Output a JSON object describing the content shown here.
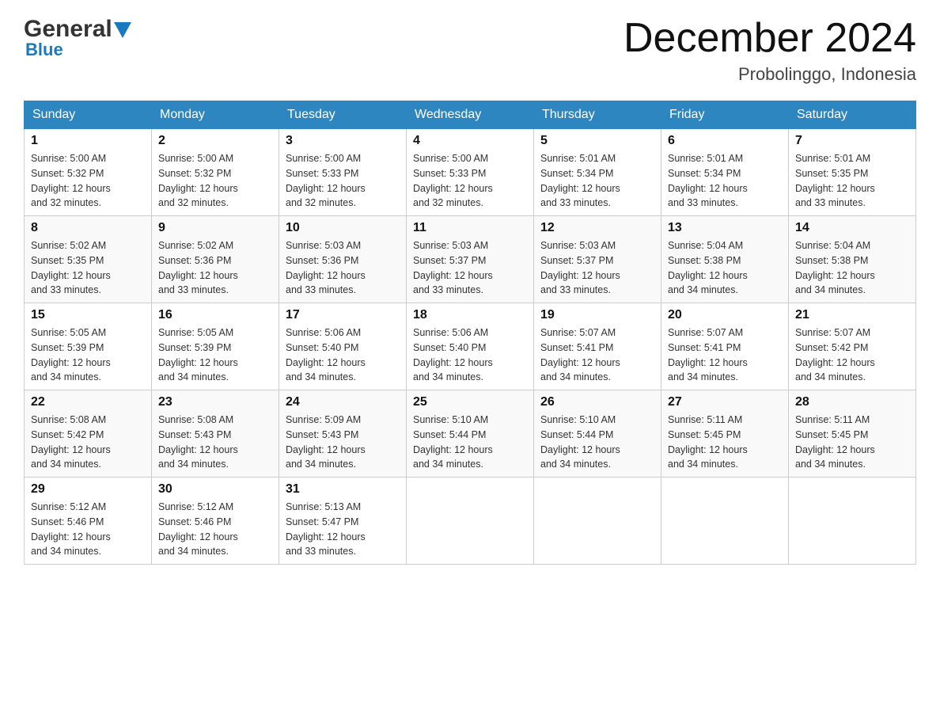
{
  "header": {
    "logo_general": "General",
    "logo_blue": "Blue",
    "month_year": "December 2024",
    "location": "Probolinggo, Indonesia"
  },
  "days_of_week": [
    "Sunday",
    "Monday",
    "Tuesday",
    "Wednesday",
    "Thursday",
    "Friday",
    "Saturday"
  ],
  "weeks": [
    [
      {
        "num": "1",
        "sunrise": "5:00 AM",
        "sunset": "5:32 PM",
        "daylight": "12 hours and 32 minutes."
      },
      {
        "num": "2",
        "sunrise": "5:00 AM",
        "sunset": "5:32 PM",
        "daylight": "12 hours and 32 minutes."
      },
      {
        "num": "3",
        "sunrise": "5:00 AM",
        "sunset": "5:33 PM",
        "daylight": "12 hours and 32 minutes."
      },
      {
        "num": "4",
        "sunrise": "5:00 AM",
        "sunset": "5:33 PM",
        "daylight": "12 hours and 32 minutes."
      },
      {
        "num": "5",
        "sunrise": "5:01 AM",
        "sunset": "5:34 PM",
        "daylight": "12 hours and 33 minutes."
      },
      {
        "num": "6",
        "sunrise": "5:01 AM",
        "sunset": "5:34 PM",
        "daylight": "12 hours and 33 minutes."
      },
      {
        "num": "7",
        "sunrise": "5:01 AM",
        "sunset": "5:35 PM",
        "daylight": "12 hours and 33 minutes."
      }
    ],
    [
      {
        "num": "8",
        "sunrise": "5:02 AM",
        "sunset": "5:35 PM",
        "daylight": "12 hours and 33 minutes."
      },
      {
        "num": "9",
        "sunrise": "5:02 AM",
        "sunset": "5:36 PM",
        "daylight": "12 hours and 33 minutes."
      },
      {
        "num": "10",
        "sunrise": "5:03 AM",
        "sunset": "5:36 PM",
        "daylight": "12 hours and 33 minutes."
      },
      {
        "num": "11",
        "sunrise": "5:03 AM",
        "sunset": "5:37 PM",
        "daylight": "12 hours and 33 minutes."
      },
      {
        "num": "12",
        "sunrise": "5:03 AM",
        "sunset": "5:37 PM",
        "daylight": "12 hours and 33 minutes."
      },
      {
        "num": "13",
        "sunrise": "5:04 AM",
        "sunset": "5:38 PM",
        "daylight": "12 hours and 34 minutes."
      },
      {
        "num": "14",
        "sunrise": "5:04 AM",
        "sunset": "5:38 PM",
        "daylight": "12 hours and 34 minutes."
      }
    ],
    [
      {
        "num": "15",
        "sunrise": "5:05 AM",
        "sunset": "5:39 PM",
        "daylight": "12 hours and 34 minutes."
      },
      {
        "num": "16",
        "sunrise": "5:05 AM",
        "sunset": "5:39 PM",
        "daylight": "12 hours and 34 minutes."
      },
      {
        "num": "17",
        "sunrise": "5:06 AM",
        "sunset": "5:40 PM",
        "daylight": "12 hours and 34 minutes."
      },
      {
        "num": "18",
        "sunrise": "5:06 AM",
        "sunset": "5:40 PM",
        "daylight": "12 hours and 34 minutes."
      },
      {
        "num": "19",
        "sunrise": "5:07 AM",
        "sunset": "5:41 PM",
        "daylight": "12 hours and 34 minutes."
      },
      {
        "num": "20",
        "sunrise": "5:07 AM",
        "sunset": "5:41 PM",
        "daylight": "12 hours and 34 minutes."
      },
      {
        "num": "21",
        "sunrise": "5:07 AM",
        "sunset": "5:42 PM",
        "daylight": "12 hours and 34 minutes."
      }
    ],
    [
      {
        "num": "22",
        "sunrise": "5:08 AM",
        "sunset": "5:42 PM",
        "daylight": "12 hours and 34 minutes."
      },
      {
        "num": "23",
        "sunrise": "5:08 AM",
        "sunset": "5:43 PM",
        "daylight": "12 hours and 34 minutes."
      },
      {
        "num": "24",
        "sunrise": "5:09 AM",
        "sunset": "5:43 PM",
        "daylight": "12 hours and 34 minutes."
      },
      {
        "num": "25",
        "sunrise": "5:10 AM",
        "sunset": "5:44 PM",
        "daylight": "12 hours and 34 minutes."
      },
      {
        "num": "26",
        "sunrise": "5:10 AM",
        "sunset": "5:44 PM",
        "daylight": "12 hours and 34 minutes."
      },
      {
        "num": "27",
        "sunrise": "5:11 AM",
        "sunset": "5:45 PM",
        "daylight": "12 hours and 34 minutes."
      },
      {
        "num": "28",
        "sunrise": "5:11 AM",
        "sunset": "5:45 PM",
        "daylight": "12 hours and 34 minutes."
      }
    ],
    [
      {
        "num": "29",
        "sunrise": "5:12 AM",
        "sunset": "5:46 PM",
        "daylight": "12 hours and 34 minutes."
      },
      {
        "num": "30",
        "sunrise": "5:12 AM",
        "sunset": "5:46 PM",
        "daylight": "12 hours and 34 minutes."
      },
      {
        "num": "31",
        "sunrise": "5:13 AM",
        "sunset": "5:47 PM",
        "daylight": "12 hours and 33 minutes."
      },
      null,
      null,
      null,
      null
    ]
  ],
  "labels": {
    "sunrise": "Sunrise:",
    "sunset": "Sunset:",
    "daylight": "Daylight:"
  }
}
